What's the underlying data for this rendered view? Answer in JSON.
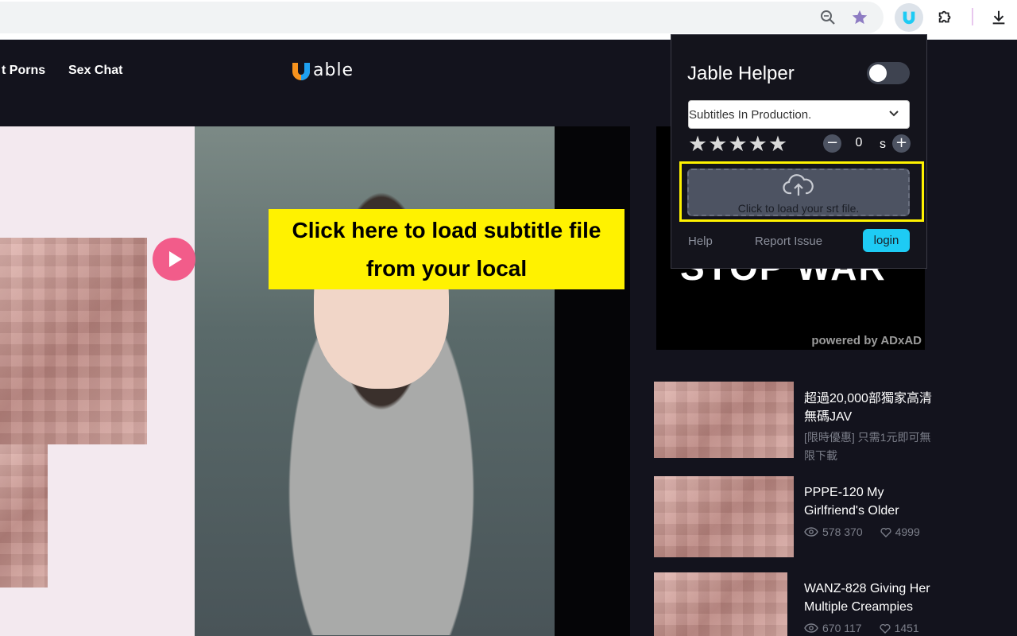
{
  "site": {
    "nav": [
      "t Porns",
      "Sex Chat"
    ],
    "logo_text": "able"
  },
  "cover": {
    "callout_line1": "Click here to load subtitle file",
    "callout_line2": "from your local"
  },
  "ad": {
    "headline": "STOP WAR",
    "powered": "powered by ADxAD"
  },
  "extension": {
    "title": "Jable Helper",
    "toggle_on": false,
    "select_value": "Subtitles In Production.",
    "rating_stars": 5,
    "offset_value": "0",
    "offset_unit": "s",
    "upload_text": "Click to load your srt file.",
    "help_label": "Help",
    "report_label": "Report Issue",
    "login_label": "login"
  },
  "related": [
    {
      "title": "超過20,000部獨家高清無碼JAV",
      "sub": "[限時優惠] 只需1元即可無限下載"
    },
    {
      "title": "PPPE-120 My Girlfriend's Older",
      "views": "578 370",
      "likes": "4999"
    },
    {
      "title": "WANZ-828 Giving Her Multiple Creampies",
      "views": "670 117",
      "likes": "1451"
    }
  ],
  "colors": {
    "accent_cyan": "#1ecbf4",
    "callout_yellow": "#fff200",
    "play_pink": "#f25c8a",
    "background": "#13131d"
  }
}
